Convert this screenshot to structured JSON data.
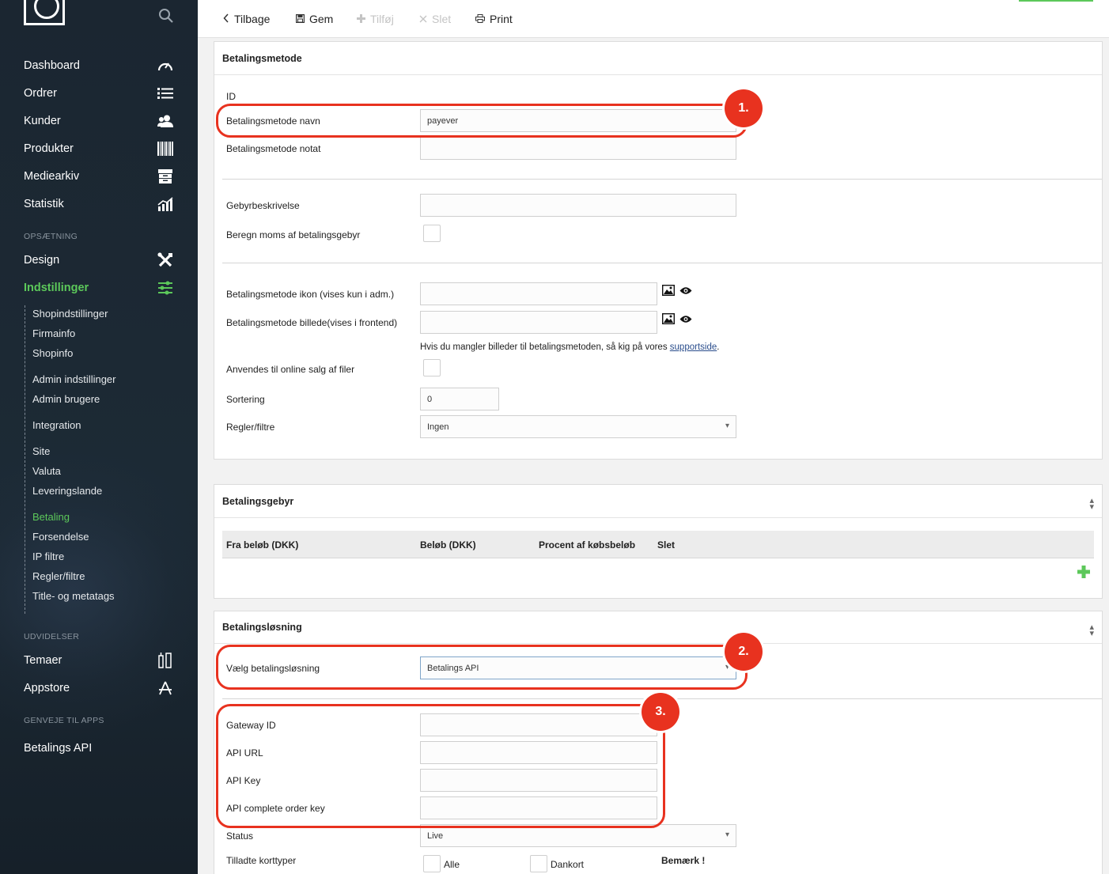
{
  "sidebar": {
    "nav": [
      {
        "label": "Dashboard",
        "icon": "speedometer-icon"
      },
      {
        "label": "Ordrer",
        "icon": "list-icon"
      },
      {
        "label": "Kunder",
        "icon": "users-icon"
      },
      {
        "label": "Produkter",
        "icon": "barcode-icon"
      },
      {
        "label": "Mediearkiv",
        "icon": "archive-icon"
      },
      {
        "label": "Statistik",
        "icon": "chart-icon"
      }
    ],
    "section_setup": "OPSÆTNING",
    "setup_nav": [
      {
        "label": "Design",
        "icon": "tools-icon"
      },
      {
        "label": "Indstillinger",
        "icon": "sliders-icon"
      }
    ],
    "sub_items": [
      "Shopindstillinger",
      "Firmainfo",
      "Shopinfo",
      "Admin indstillinger",
      "Admin brugere",
      "Integration",
      "Site",
      "Valuta",
      "Leveringslande",
      "Betaling",
      "Forsendelse",
      "IP filtre",
      "Regler/filtre",
      "Title- og metatags"
    ],
    "section_ext": "UDVIDELSER",
    "ext_nav": [
      {
        "label": "Temaer",
        "icon": "theme-icon"
      },
      {
        "label": "Appstore",
        "icon": "appstore-icon"
      }
    ],
    "section_shortcuts": "GENVEJE TIL APPS",
    "shortcut": "Betalings API"
  },
  "toolbar": {
    "back": "Tilbage",
    "save": "Gem",
    "add": "Tilføj",
    "delete": "Slet",
    "print": "Print"
  },
  "payment_method": {
    "title": "Betalingsmetode",
    "id_label": "ID",
    "name_label": "Betalingsmetode navn",
    "name_value": "payever",
    "note_label": "Betalingsmetode notat",
    "fee_desc_label": "Gebyrbeskrivelse",
    "vat_label": "Beregn moms af betalingsgebyr",
    "icon_label": "Betalingsmetode ikon (vises kun i adm.)",
    "image_label": "Betalingsmetode billede(vises i frontend)",
    "hint_text": "Hvis du mangler billeder til betalingsmetoden, så kig på vores ",
    "hint_link": "supportside",
    "hint_end": ".",
    "online_label": "Anvendes til online salg af filer",
    "sort_label": "Sortering",
    "sort_value": "0",
    "rules_label": "Regler/filtre",
    "rules_value": "Ingen"
  },
  "fee": {
    "title": "Betalingsgebyr",
    "columns": [
      "Fra beløb (DKK)",
      "Beløb (DKK)",
      "Procent af købsbeløb",
      "Slet"
    ]
  },
  "solution": {
    "title": "Betalingsløsning",
    "choose_label": "Vælg betalingsløsning",
    "choose_value": "Betalings API",
    "gateway_label": "Gateway ID",
    "api_url_label": "API URL",
    "api_key_label": "API Key",
    "complete_key_label": "API complete order key",
    "status_label": "Status",
    "status_value": "Live",
    "cards_label": "Tilladte korttyper",
    "card_all": "Alle",
    "card_dankort": "Dankort",
    "note": "Bemærk !"
  },
  "annotations": [
    "1.",
    "2.",
    "3."
  ],
  "colors": {
    "accent": "#5cc85a",
    "annotation": "#e8321f",
    "sidebar": "#1b2631"
  }
}
